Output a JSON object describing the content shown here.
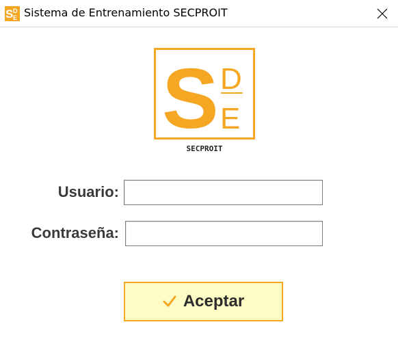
{
  "window": {
    "title": "Sistema de Entrenamiento SECPROIT",
    "close_icon": "close-icon",
    "app_icon": "sde-logo-icon"
  },
  "logo": {
    "letters": [
      "S",
      "D",
      "E"
    ],
    "caption": "SECPROIT",
    "brand_color": "#F5A623"
  },
  "form": {
    "user_label": "Usuario:",
    "user_value": "",
    "pass_label": "Contraseña:",
    "pass_value": ""
  },
  "accept_button": {
    "label": "Aceptar",
    "icon": "checkmark-icon",
    "background": "#FCFCC4",
    "border": "#F5A623"
  }
}
